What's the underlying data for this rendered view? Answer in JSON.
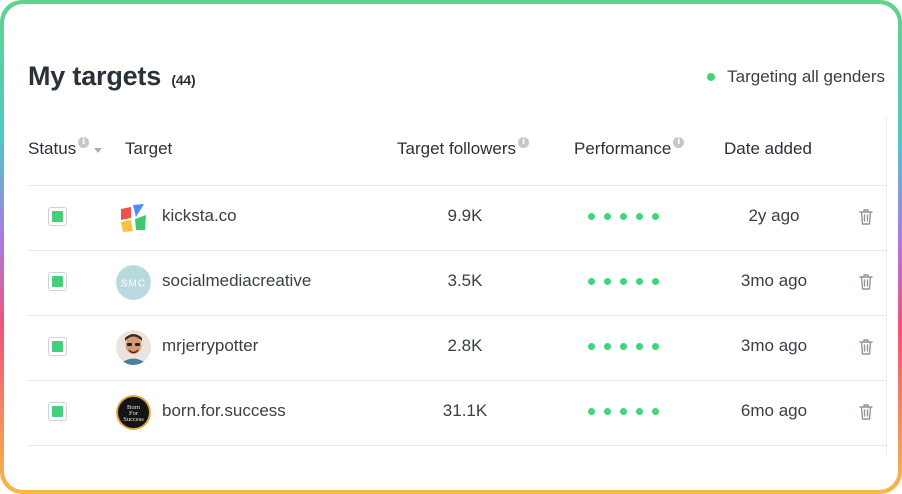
{
  "header": {
    "title": "My targets",
    "count": "(44)",
    "gender_label": "Targeting all genders"
  },
  "columns": {
    "status": "Status",
    "target": "Target",
    "followers": "Target followers",
    "performance": "Performance",
    "date": "Date added"
  },
  "rows": [
    {
      "name": "kicksta.co",
      "followers": "9.9K",
      "date": "2y ago",
      "checked": true,
      "performance_dots": 5
    },
    {
      "name": "socialmediacreative",
      "followers": "3.5K",
      "date": "3mo ago",
      "checked": true,
      "performance_dots": 5,
      "avatar_text": "SMC"
    },
    {
      "name": "mrjerrypotter",
      "followers": "2.8K",
      "date": "3mo ago",
      "checked": true,
      "performance_dots": 5
    },
    {
      "name": "born.for.success",
      "followers": "31.1K",
      "date": "6mo ago",
      "checked": true,
      "performance_dots": 5,
      "avatar_text": "Born For Success"
    }
  ],
  "colors": {
    "accent_green": "#3fd57a",
    "text": "#2b3138"
  }
}
